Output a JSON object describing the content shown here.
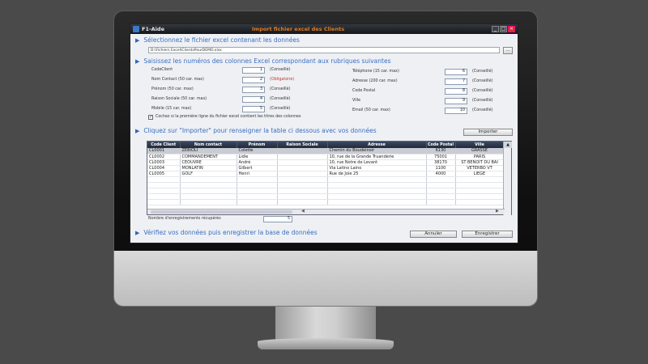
{
  "window": {
    "app_name": "F1-Aide",
    "title": "Import fichier excel  des Clients",
    "minimize_glyph": "_",
    "maximize_glyph": "□",
    "close_glyph": "×"
  },
  "section1": {
    "heading": "Sélectionnez le fichier excel contenant les données",
    "file_path": "D:\\Fichiers Excel\\ClientsPourDEMO.xlsx",
    "browse_label": "..."
  },
  "section2": {
    "heading": "Saisissez les numéros des colonnes Excel correspondant aux rubriques suivantes",
    "left_fields": [
      {
        "label": "CodeClient",
        "value": "1",
        "note": "(Conseillé)"
      },
      {
        "label": "Nom Contact (50 car. max)",
        "value": "2",
        "note": "(Obligatoire)"
      },
      {
        "label": "Prénom (50 car. max)",
        "value": "3",
        "note": "(Conseillé)"
      },
      {
        "label": "Raison Sociale (50 car. max)",
        "value": "4",
        "note": "(Conseillé)"
      },
      {
        "label": "Mobile (15 car. max)",
        "value": "5",
        "note": "(Conseillé)"
      }
    ],
    "right_fields": [
      {
        "label": "Téléphone (15 car. max)",
        "value": "6",
        "note": "(Conseillé)"
      },
      {
        "label": "Adresse (200 car. max)",
        "value": "7",
        "note": "(Conseillé)"
      },
      {
        "label": "Code Postal",
        "value": "8",
        "note": "(Conseillé)"
      },
      {
        "label": "Ville",
        "value": "9",
        "note": "(Conseillé)"
      },
      {
        "label": "Email (50 car. max)",
        "value": "10",
        "note": "(Conseillé)"
      }
    ],
    "checkbox_checked": true,
    "checkbox_label": "Cochez si la première ligne du fichier excel contient les titres des colonnes"
  },
  "section3": {
    "heading": "Cliquez sur \"Importer\" pour renseigner la table ci dessous avec vos données",
    "import_button": "Importer"
  },
  "table": {
    "columns": [
      "Code Client",
      "Nom contact",
      "Prénom",
      "Raison Sociale",
      "Adresse",
      "Code Postal",
      "Ville"
    ],
    "rows": [
      [
        "CL0001",
        "ZEBIOLI",
        "Colette",
        "",
        "Chemin du Boudeinoir",
        "6130",
        "GRASSE"
      ],
      [
        "CL0002",
        "COMMANDEMENT",
        "Lidie",
        "",
        "10, rue de la Grande Truanderie",
        "75001",
        "PARIS"
      ],
      [
        "CL0003",
        "CEOUVRE",
        "André",
        "",
        "10, rue Notre de Levant",
        "38170",
        "ST BENOIT DU BAI"
      ],
      [
        "CL0004",
        "MONLATIN",
        "Gilbert",
        "",
        "Via Latino Laino",
        "1100",
        "VETERBO VT"
      ],
      [
        "CL0005",
        "GOLF",
        "Henri",
        "",
        "Rue de Joie 25",
        "4000",
        "LIEGE"
      ]
    ],
    "selected_row": 0
  },
  "footer": {
    "count_label": "Nombre d'enregistrements récupérés",
    "count_value": "5",
    "section4_heading": "Vérifiez vos données puis enregistrer la base de données",
    "cancel_button": "Annuler",
    "save_button": "Enregistrer"
  },
  "icons": {
    "section_arrow": "▶",
    "checkmark": "✓",
    "scroll_up": "▲",
    "scroll_left": "◀",
    "scroll_right": "▶"
  }
}
